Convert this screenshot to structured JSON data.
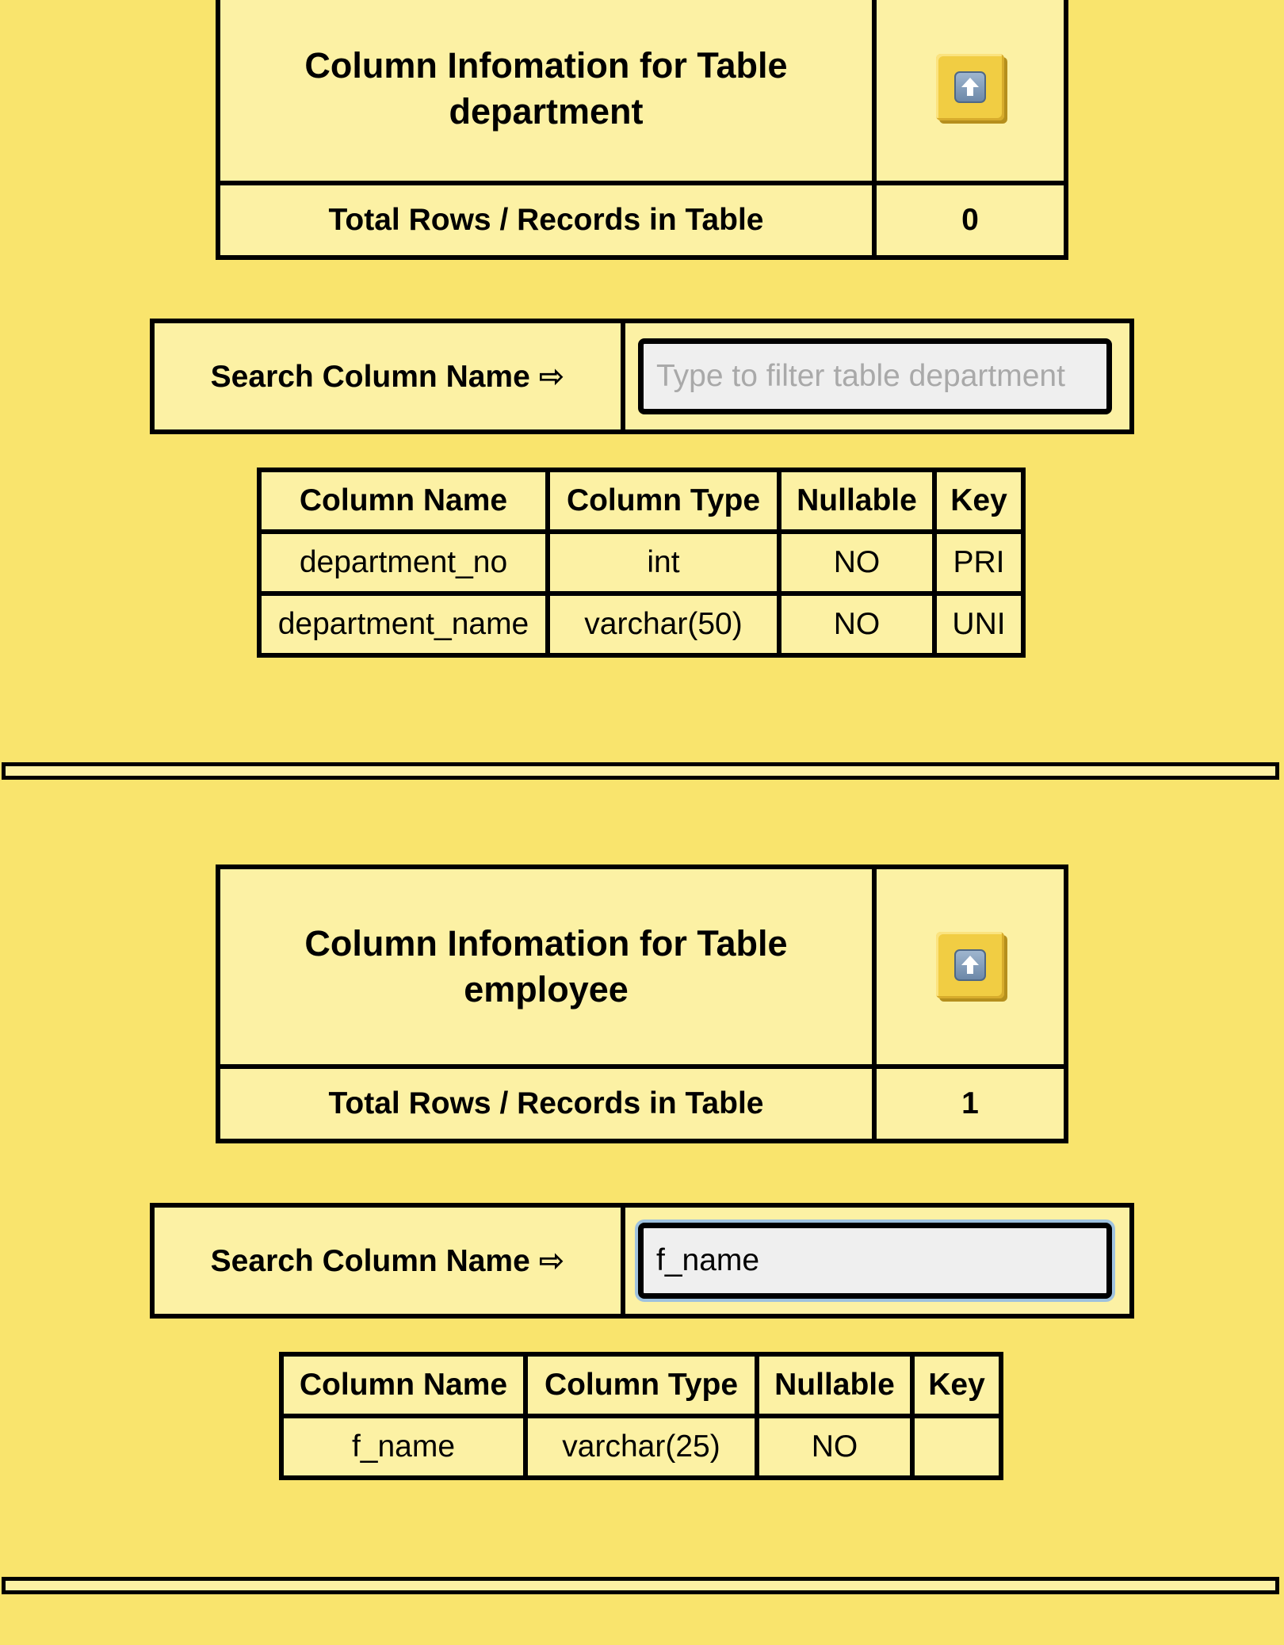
{
  "tables": [
    {
      "title_line1": "Column Infomation for Table",
      "title_line2": "department",
      "rows_label": "Total Rows / Records in Table",
      "rows_value": "0",
      "search_label": "Search Column Name ⇨",
      "search_value": "",
      "search_placeholder": "Type to filter table department",
      "columns_header": [
        "Column Name",
        "Column Type",
        "Nullable",
        "Key"
      ],
      "rows": [
        [
          "department_no",
          "int",
          "NO",
          "PRI"
        ],
        [
          "department_name",
          "varchar(50)",
          "NO",
          "UNI"
        ]
      ]
    },
    {
      "title_line1": "Column Infomation for Table",
      "title_line2": "employee",
      "rows_label": "Total Rows / Records in Table",
      "rows_value": "1",
      "search_label": "Search Column Name ⇨",
      "search_value": "f_name",
      "search_placeholder": "",
      "columns_header": [
        "Column Name",
        "Column Type",
        "Nullable",
        "Key"
      ],
      "rows": [
        [
          "f_name",
          "varchar(25)",
          "NO",
          ""
        ]
      ]
    }
  ],
  "icons": {
    "scroll_top": "arrow-up-icon"
  },
  "colors": {
    "background": "#f9e46d",
    "panel": "#fcf1a4",
    "border": "#000000"
  }
}
